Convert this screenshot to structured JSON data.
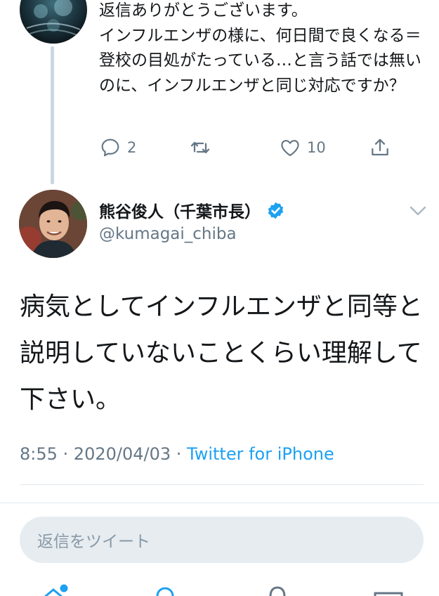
{
  "parent_tweet": {
    "text": "返信ありがとうございます。\nインフルエンザの様に、何日間で良くなる＝登校の目処がたっている…と言う話では無いのに、インフルエンザと同じ対応ですか？",
    "actions": {
      "reply_count": "2",
      "retweet_count": "",
      "like_count": "10"
    }
  },
  "tweet": {
    "author_name": "熊谷俊人（千葉市長）",
    "author_handle": "@kumagai_chiba",
    "verified": true,
    "text": "病気としてインフルエンザと同等と説明していないことくらい理解して下さい。",
    "time": "8:55",
    "date": "2020/04/03",
    "separator": " · ",
    "client": "Twitter for iPhone"
  },
  "reply_bar": {
    "placeholder": "返信をツイート"
  },
  "colors": {
    "accent": "#1da1f2",
    "secondary_text": "#657786",
    "primary_text": "#14171a",
    "thread_line": "#ccd6dd"
  },
  "icons": {
    "reply": "reply-icon",
    "retweet": "retweet-icon",
    "like": "heart-icon",
    "share": "share-icon",
    "verified": "verified-badge-icon",
    "more": "chevron-down-icon"
  }
}
